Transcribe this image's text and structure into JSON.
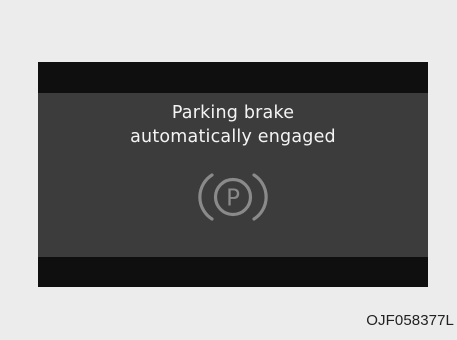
{
  "display": {
    "message_line1": "Parking brake",
    "message_line2": "automatically engaged",
    "indicator_icon": "parking-brake-icon",
    "indicator_letter": "P",
    "colors": {
      "background": "#ececec",
      "screen": "#3c3c3c",
      "bars": "#0f0f0f",
      "text": "#f4f4f4",
      "icon": "#8a8a8a"
    }
  },
  "caption": "OJF058377L"
}
